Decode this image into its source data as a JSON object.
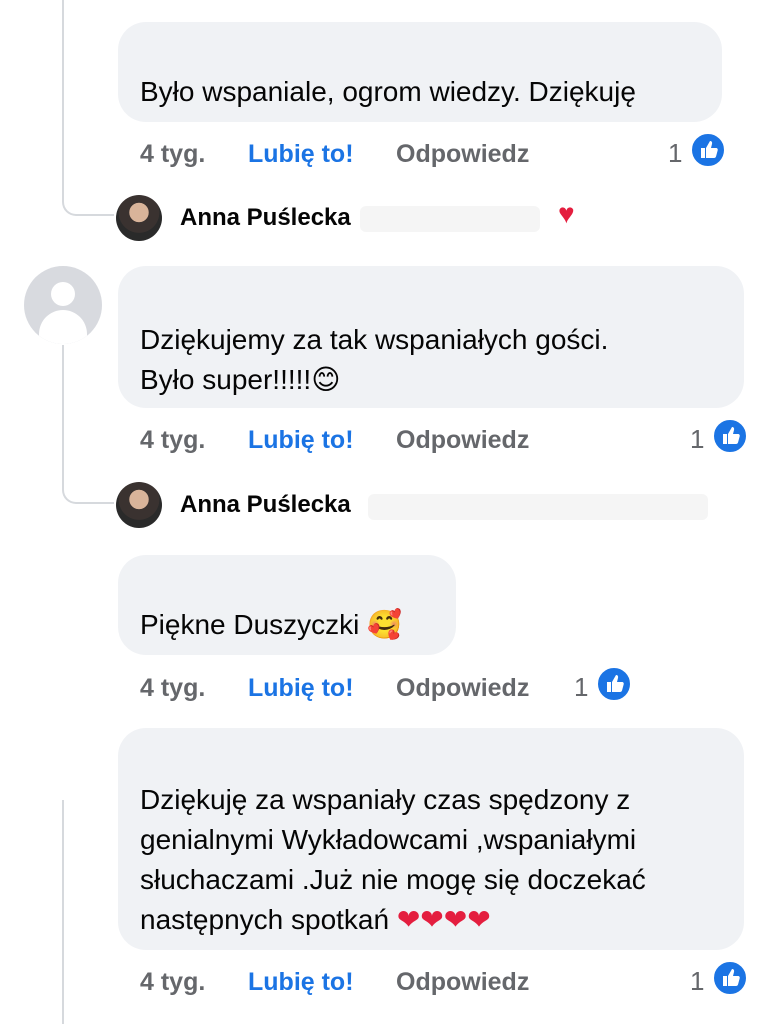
{
  "comments": [
    {
      "text": "Było wspaniale, ogrom wiedzy. Dziękuję",
      "time": "4 tyg.",
      "like_label": "Lubię to!",
      "reply_label": "Odpowiedz",
      "like_count": "1"
    },
    {
      "text": "Dziękujemy za tak wspaniałych gości.\nByło super!!!!!",
      "emoji": "😊",
      "time": "4 tyg.",
      "like_label": "Lubię to!",
      "reply_label": "Odpowiedz",
      "like_count": "1"
    },
    {
      "text": "Piękne Duszyczki",
      "emoji": "🥰",
      "time": "4 tyg.",
      "like_label": "Lubię to!",
      "reply_label": "Odpowiedz",
      "like_count": "1"
    },
    {
      "text": "Dziękuję za wspaniały czas spędzony z\ngenialnymi Wykładowcami ,wspaniałymi\nsłuchaczami .Już nie mogę się doczekać\nnastępnych spotkań",
      "emoji": "❤❤❤❤",
      "time": "4 tyg.",
      "like_label": "Lubię to!",
      "reply_label": "Odpowiedz",
      "like_count": "1"
    }
  ],
  "replies": [
    {
      "author": "Anna Puślecka",
      "reaction": "♥"
    },
    {
      "author": "Anna Puślecka"
    }
  ],
  "icons": {
    "like": "thumbs-up-icon",
    "default_avatar": "default-avatar-icon",
    "heart": "heart-icon"
  },
  "colors": {
    "like_blue": "#1b74e4",
    "bubble_bg": "#f0f2f5",
    "meta_gray": "#65676b",
    "heart_red": "#e41e3f"
  }
}
